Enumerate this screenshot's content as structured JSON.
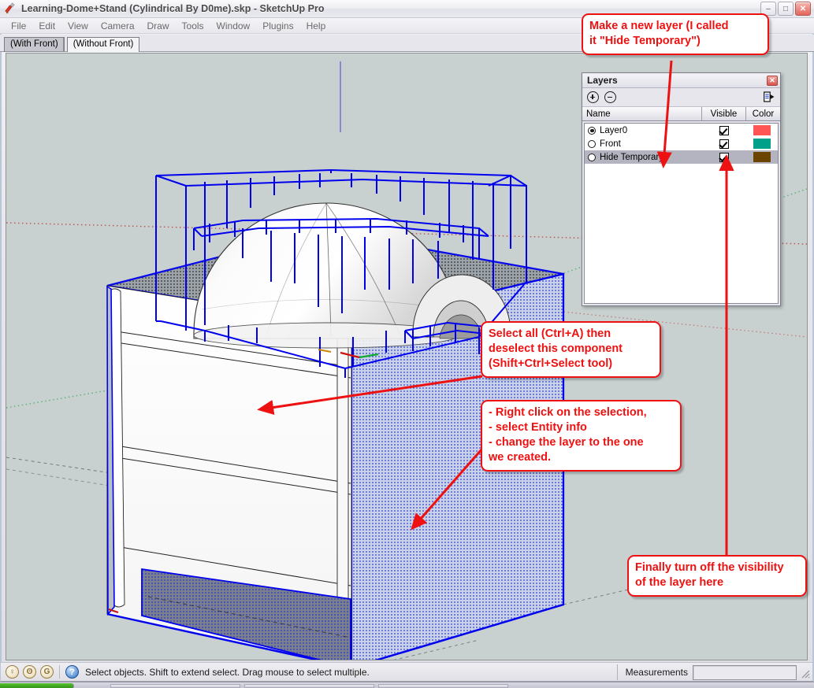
{
  "window": {
    "title": "Learning-Dome+Stand (Cylindrical By D0me).skp - SketchUp Pro",
    "app_icon": "sketchup-pencil-icon",
    "minimize_label": "–",
    "maximize_label": "□",
    "close_label": "✕"
  },
  "menu": {
    "items": [
      {
        "label": "File"
      },
      {
        "label": "Edit"
      },
      {
        "label": "View"
      },
      {
        "label": "Camera"
      },
      {
        "label": "Draw"
      },
      {
        "label": "Tools"
      },
      {
        "label": "Window"
      },
      {
        "label": "Plugins"
      },
      {
        "label": "Help"
      }
    ]
  },
  "scene_tabs": [
    {
      "label": "(With Front)",
      "active": true
    },
    {
      "label": "(Without Front)",
      "active": false
    }
  ],
  "layers_panel": {
    "title": "Layers",
    "close_label": "✕",
    "add_button": "add-layer-button",
    "remove_button": "remove-layer-button",
    "flyout_button": "layer-options-flyout",
    "columns": [
      {
        "label": "Name"
      },
      {
        "label": "Visible"
      },
      {
        "label": "Color"
      }
    ],
    "rows": [
      {
        "name": "Layer0",
        "active": true,
        "visible": true,
        "color": "#ff5555",
        "selected": false
      },
      {
        "name": "Front",
        "active": false,
        "visible": true,
        "color": "#00a08a",
        "selected": false
      },
      {
        "name": "Hide Temporary",
        "active": false,
        "visible": true,
        "color": "#6b4500",
        "selected": true
      }
    ]
  },
  "callouts": [
    {
      "id": "callout-new-layer",
      "text": "Make a new layer (I called\nit \"Hide Temporary\")"
    },
    {
      "id": "callout-select-all",
      "text": "Select all (Ctrl+A) then\ndeselect this component\n(Shift+Ctrl+Select tool)"
    },
    {
      "id": "callout-entity-info",
      "text": "- Right click on the selection,\n- select Entity info\n- change the layer to the one\nwe created."
    },
    {
      "id": "callout-visibility",
      "text": "Finally turn off the visibility\nof the layer here"
    }
  ],
  "statusbar": {
    "icons": [
      {
        "name": "geo-location-icon",
        "glyph": "♀"
      },
      {
        "name": "person-icon",
        "glyph": "ʘ"
      },
      {
        "name": "google-icon",
        "glyph": "G"
      }
    ],
    "help_glyph": "?",
    "message": "Select objects. Shift to extend select. Drag mouse to select multiple.",
    "measurements_label": "Measurements",
    "measurements_value": "",
    "measurements_placeholder": ""
  },
  "colors": {
    "annotation_red": "#ee1111",
    "selection_blue": "#0000ee",
    "viewport_bg": "#c8d0d0",
    "axis_red": "#bb2222",
    "axis_green": "#22aa44"
  }
}
